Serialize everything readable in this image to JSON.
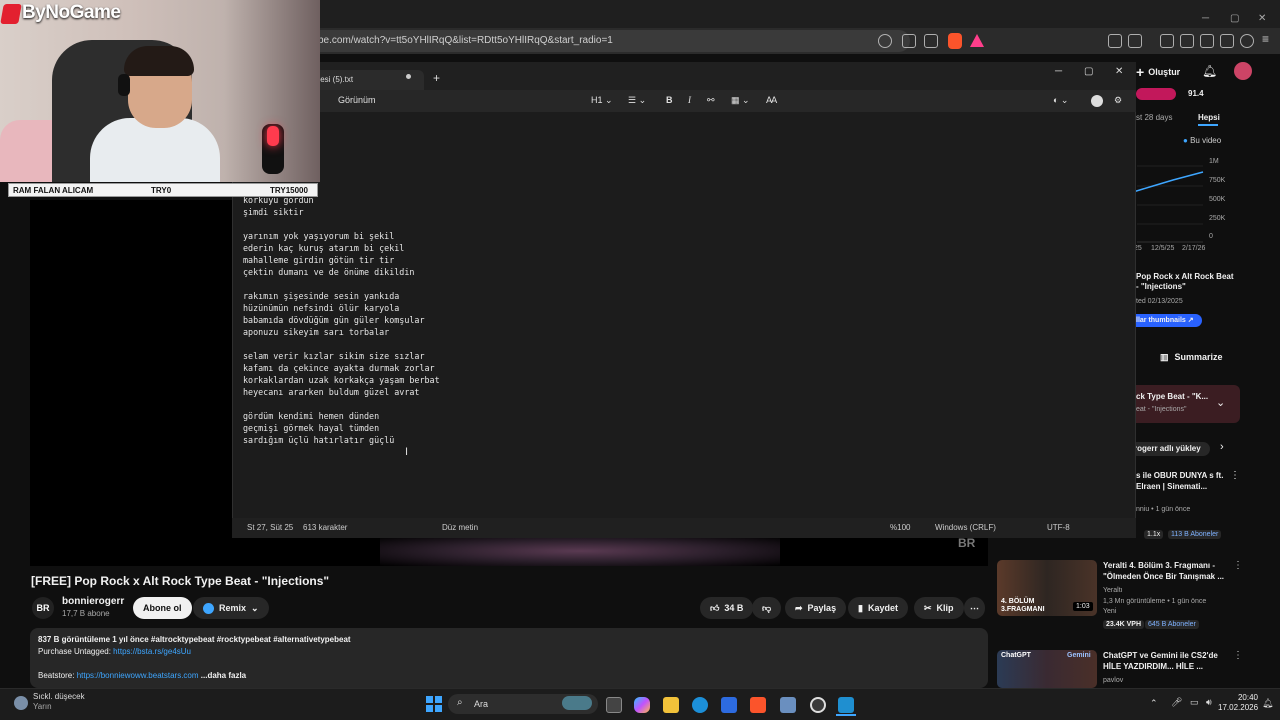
{
  "browser": {
    "url": "be.com/watch?v=tt5oYHlIRqQ&list=RDtt5oYHlIRqQ&start_radio=1",
    "create_label": "Oluştur"
  },
  "youtube": {
    "title": "[FREE] Pop Rock x Alt Rock Type Beat - \"Injections\"",
    "channel_name": "bonnierogerr",
    "channel_subs": "17,7 B abone",
    "subscribe_label": "Abone ol",
    "remix_label": "Remix",
    "likes": "34 B",
    "share_label": "Paylaş",
    "save_label": "Kaydet",
    "clip_label": "Klip",
    "desc_line1": "837 B görüntüleme  1 yıl önce  #altrocktypebeat #rocktypebeat #alternativetypebeat",
    "desc_purchase": "Purchase Untagged:",
    "desc_purchase_link": "https://bsta.rs/ge4sUu",
    "desc_beatstore": "Beatstore:",
    "desc_beatstore_link": "https://bonniewoww.beatstars.com",
    "desc_more": "...daha fazla"
  },
  "right_panel": {
    "stat_value": "91.4",
    "range_label": "st 28 days",
    "all_label": "Hepsi",
    "legend_label": "Bu video",
    "y_ticks": [
      "1M",
      "750K",
      "500K",
      "250K",
      "0"
    ],
    "x_ticks": [
      "25",
      "12/5/25",
      "2/17/26"
    ],
    "card_title": "Pop Rock x Alt Rock Beat - \"Injections\"",
    "card_date": "ted 02/13/2025",
    "card_btn": "llar thumbnails ↗",
    "summarize": "Summarize",
    "playlist_title": "ck Type Beat - \"K...",
    "playlist_sub": "eat - \"Injections\"",
    "upload_by": "rogerr adlı yükley",
    "rec0_title": "s ile OBUR DUNYA s ft. Elraen | Sinemati...",
    "rec0_meta": "nniu • 1 gün önce",
    "rec0_badge1": "1.1x",
    "rec0_badge2": "113 B Aboneler"
  },
  "recommendations": [
    {
      "title": "Yeralti 4. Bölüm 3. Fragmanı - \"Ölmeden Önce Bir Tanışmak ...",
      "channel": "Yeraltı",
      "meta": "1,3 Mn görüntüleme • 1 gün önce",
      "new": "Yeni",
      "badge1": "23.4K VPH",
      "badge2": "645 B Aboneler",
      "thumb_text": "4. BÖLÜM 3.FRAGMANI",
      "duration": "1:03"
    },
    {
      "title": "ChatGPT ve Gemini ile CS2'de HİLE YAZDIRDIM... HİLE ...",
      "channel": "pavlov",
      "thumb_text1": "ChatGPT",
      "thumb_text2": "Gemini"
    }
  ],
  "notepad": {
    "tab_title": "lgesi (5).txt",
    "menu_view": "Görünüm",
    "heading": "H1",
    "lines": [
      "korkuyu gördün",
      "şimdi siktir",
      "",
      "yarınım yok yaşıyorum bi şekil",
      "ederin kaç kuruş atarım bi çekil",
      "mahalleme girdin götün tir tir",
      "çektin dumanı ve de önüme dikildin",
      "",
      "rakımın şişesinde sesin yankıda",
      "hüzünümün nefsindi ölür karyola",
      "babamıda dövdüğüm gün güler komşular",
      "aponuzu sikeyim sarı torbalar",
      "",
      "selam verir kızlar sikim size sızlar",
      "kafamı da çekince ayakta durmak zorlar",
      "korkaklardan uzak korkakça yaşam berbat",
      "heyecanı ararken buldum güzel avrat",
      "",
      "gördüm kendimi hemen dünden",
      "geçmişi görmek hayal tümden",
      "sardığım üçlü hatırlatır güçlü"
    ],
    "status_pos": "St 27, Süt 25",
    "status_chars": "613 karakter",
    "status_format": "Düz metin",
    "status_zoom": "%100",
    "status_eol": "Windows (CRLF)",
    "status_enc": "UTF-8"
  },
  "overlay": {
    "brand": "ByNoGame",
    "donation_1": "RAM FALAN ALICAM",
    "donation_2": "TRY0",
    "donation_3": "TRY15000"
  },
  "taskbar": {
    "weather_title": "Sıckl. düşecek",
    "weather_sub": "Yarın",
    "search_label": "Ara",
    "time": "20:40",
    "date": "17.02.2026"
  }
}
